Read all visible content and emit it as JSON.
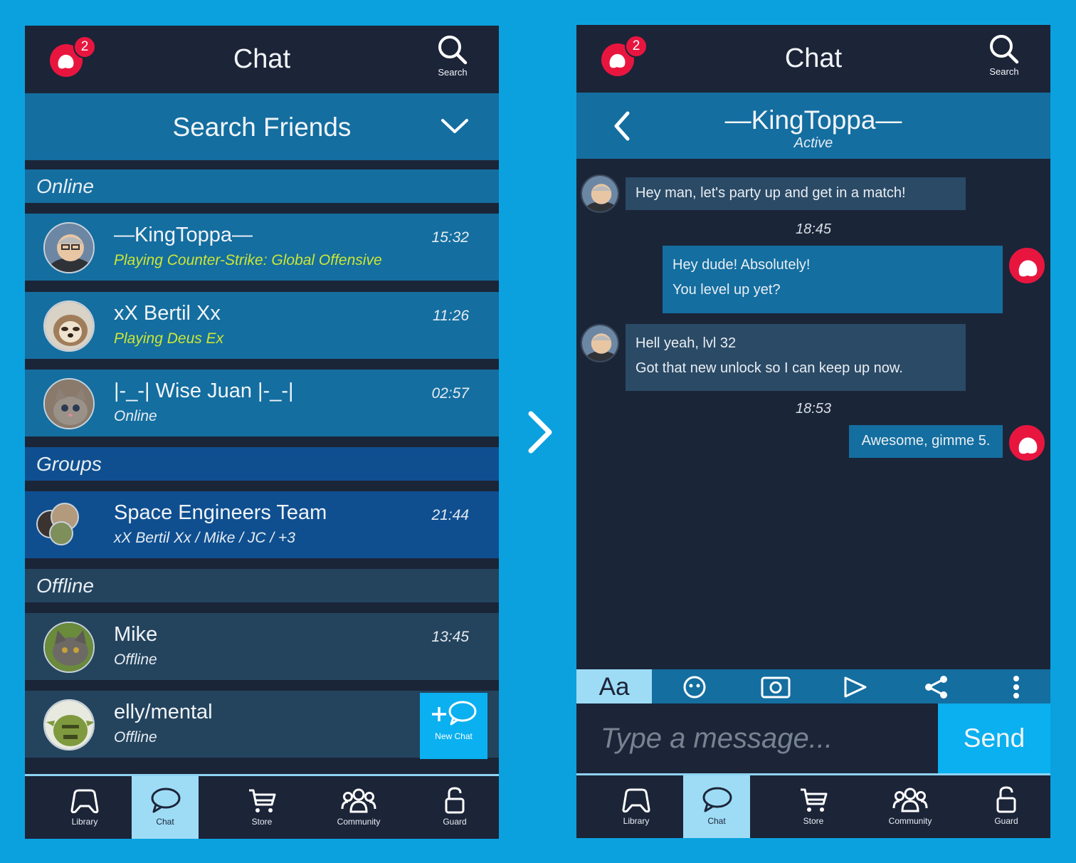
{
  "left": {
    "header": {
      "title": "Chat",
      "search_label": "Search",
      "notification_count": "2"
    },
    "search_friends_label": "Search Friends",
    "sections": {
      "online": "Online",
      "groups": "Groups",
      "offline": "Offline"
    },
    "online_friends": [
      {
        "name": "—KingToppa—",
        "status_prefix": "Playing ",
        "status_game": "Counter-Strike: Global Offensive",
        "time": "15:32"
      },
      {
        "name": "xX Bertil Xx",
        "status_prefix": "Playing ",
        "status_game": "Deus Ex",
        "time": "11:26"
      },
      {
        "name": "|-_-| Wise Juan |-_-|",
        "status": "Online",
        "time": "02:57"
      }
    ],
    "groups": [
      {
        "name": "Space Engineers Team",
        "members": "xX Bertil Xx / Mike / JC / +3",
        "time": "21:44"
      }
    ],
    "offline_friends": [
      {
        "name": "Mike",
        "status": "Offline",
        "time": "13:45"
      },
      {
        "name": "elly/mental",
        "status": "Offline"
      }
    ],
    "fab_label": "New Chat"
  },
  "nav": {
    "library": "Library",
    "chat": "Chat",
    "store": "Store",
    "community": "Community",
    "guard": "Guard",
    "active": "chat"
  },
  "right": {
    "header": {
      "title": "Chat",
      "search_label": "Search",
      "notification_count": "2"
    },
    "conversation": {
      "name": "—KingToppa—",
      "status": "Active"
    },
    "messages": [
      {
        "from": "them",
        "lines": [
          "Hey man, let's party up and get in a match!"
        ]
      },
      {
        "timestamp": "18:45"
      },
      {
        "from": "me",
        "lines": [
          "Hey dude! Absolutely!",
          "You level up yet?"
        ]
      },
      {
        "from": "them",
        "lines": [
          "Hell yeah, lvl 32",
          "Got that new unlock so I can keep up now."
        ]
      },
      {
        "timestamp": "18:53"
      },
      {
        "from": "me",
        "lines": [
          "Awesome, gimme 5."
        ]
      }
    ],
    "toolbar": {
      "text_format_label": "Aa"
    },
    "composer": {
      "placeholder": "Type a message...",
      "send_label": "Send"
    }
  },
  "colors": {
    "background": "#0ba1de",
    "dark": "#1c2438",
    "online": "#146ea0",
    "group": "#0f4f90",
    "offline": "#24445e",
    "accent": "#0ab0ef",
    "badge": "#e8163f",
    "game": "#cde634"
  }
}
